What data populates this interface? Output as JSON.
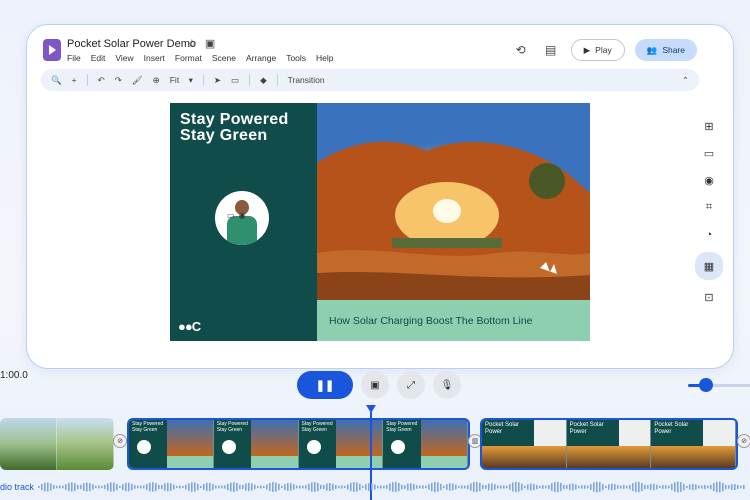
{
  "app": {
    "title": "Pocket Solar Power Demo",
    "menu": [
      "File",
      "Edit",
      "View",
      "Insert",
      "Format",
      "Scene",
      "Arrange",
      "Tools",
      "Help"
    ],
    "play_label": "Play",
    "share_label": "Share"
  },
  "toolbar": {
    "zoom_label": "Fit",
    "transition_label": "Transition",
    "icons": [
      "search-icon",
      "add-icon",
      "undo-icon",
      "redo-icon",
      "paint-format-icon",
      "zoom-icon",
      "cursor-icon",
      "comment-icon",
      "fill-color-icon",
      "collapse-icon"
    ]
  },
  "slide": {
    "title_line1": "Stay Powered",
    "title_line2": "Stay Green",
    "caption": "How Solar Charging Boost The Bottom Line"
  },
  "playback": {
    "time": "1:00.0"
  },
  "timeline": {
    "clip2_thumb_text_line1": "Stay Powered",
    "clip2_thumb_text_line2": "Stay Green",
    "clip3_thumb_text_line1": "Pocket Solar",
    "clip3_thumb_text_line2": "Power"
  },
  "audio": {
    "label": "dio track"
  },
  "colors": {
    "accent": "#1a56db",
    "slide_bg": "#0f4c4a",
    "caption_bg": "#8ecfb0"
  }
}
